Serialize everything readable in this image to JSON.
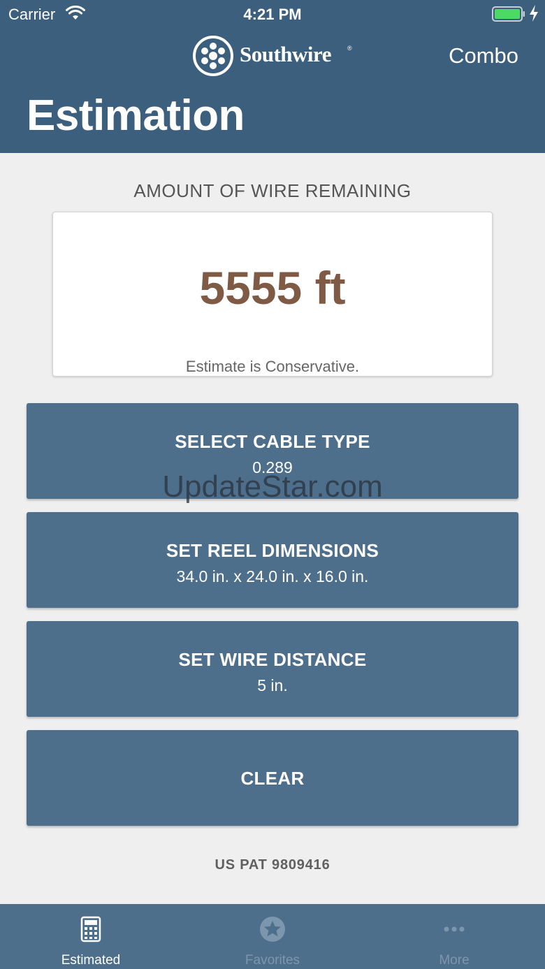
{
  "status_bar": {
    "carrier": "Carrier",
    "time": "4:21 PM",
    "battery_color": "#4cd964"
  },
  "header": {
    "logo_text": "Southwire",
    "logo_reg": "®",
    "right_label": "Combo",
    "title": "Estimation",
    "background": "#3d5f7e"
  },
  "result": {
    "label": "AMOUNT OF WIRE REMAINING",
    "value": "5555 ft",
    "note": "Estimate is Conservative.",
    "value_color": "#7f5a44"
  },
  "actions": {
    "cable_type": {
      "title": "SELECT CABLE TYPE",
      "value": "0.289"
    },
    "reel_dimensions": {
      "title": "SET REEL DIMENSIONS",
      "value": "34.0 in. x 24.0 in. x 16.0 in."
    },
    "wire_distance": {
      "title": "SET WIRE DISTANCE",
      "value": "5 in."
    },
    "clear": {
      "title": "CLEAR"
    },
    "button_color": "#4e6f8c"
  },
  "watermark": "UpdateStar.com",
  "patent": "US PAT 9809416",
  "tab_bar": {
    "tabs": [
      {
        "label": "Estimated",
        "icon": "calculator-icon",
        "active": true
      },
      {
        "label": "Favorites",
        "icon": "star-icon",
        "active": false
      },
      {
        "label": "More",
        "icon": "more-dots-icon",
        "active": false
      }
    ]
  }
}
